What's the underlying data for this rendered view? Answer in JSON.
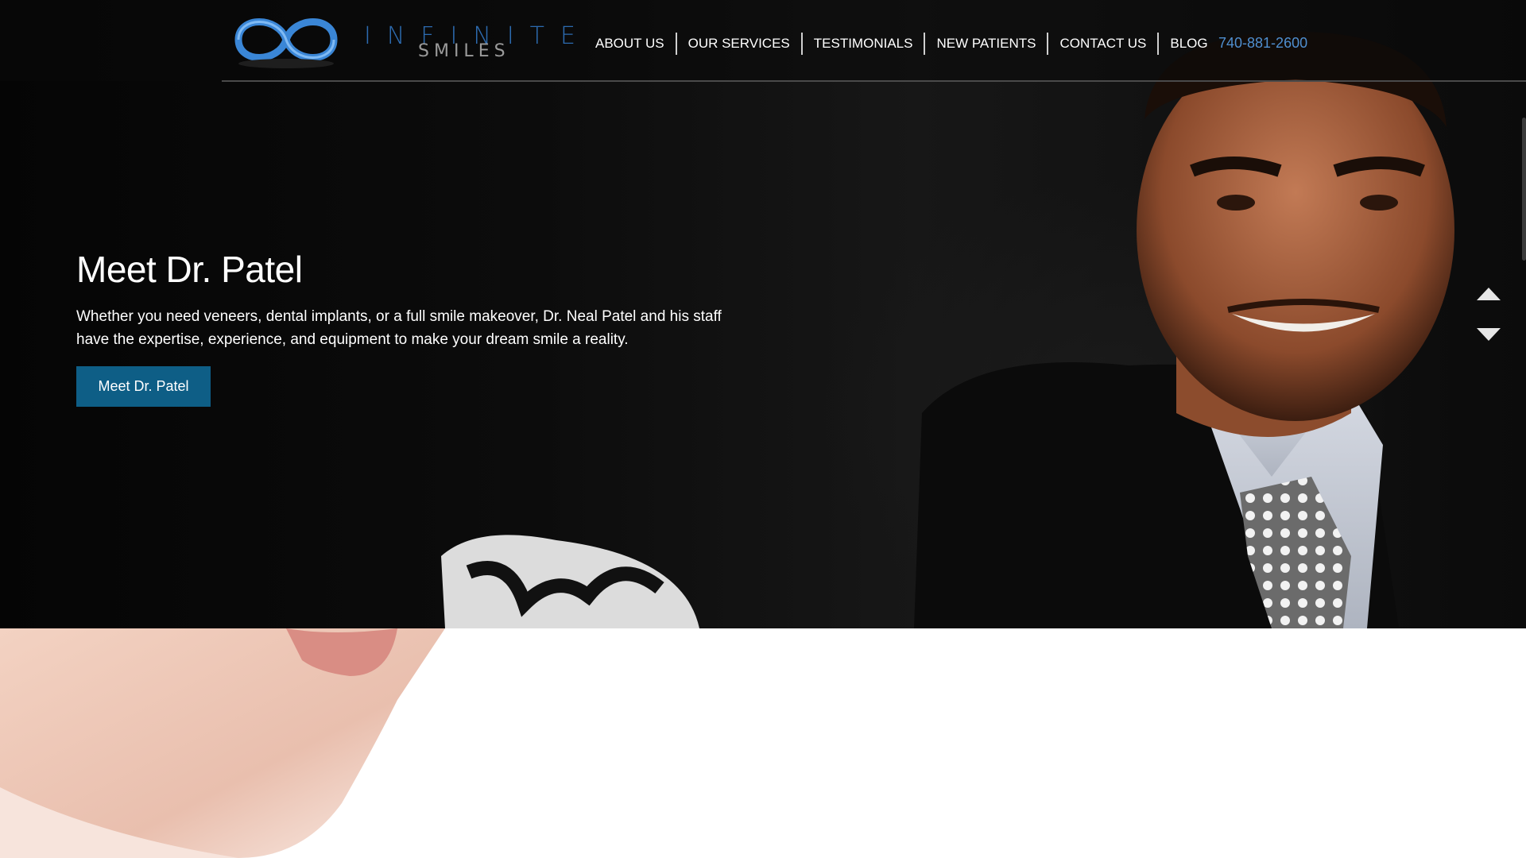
{
  "logo": {
    "line1": "INFINITE",
    "line2": "SMILES"
  },
  "nav": {
    "items": [
      "ABOUT US",
      "OUR SERVICES",
      "TESTIMONIALS",
      "NEW PATIENTS",
      "CONTACT US",
      "BLOG"
    ]
  },
  "phone": "740-881-2600",
  "hero": {
    "title": "Meet Dr. Patel",
    "body": "Whether you need veneers, dental implants, or a full smile makeover, Dr. Neal Patel and his staff have the expertise, experience, and equipment to make your dream smile a reality.",
    "cta": "Meet Dr. Patel"
  },
  "icons": {
    "slider_prev": "chevron-up-icon",
    "slider_next": "chevron-down-icon"
  },
  "colors": {
    "accent": "#0e5e86",
    "phone": "#4f8fd0",
    "logo_blue": "#2d6bb0"
  }
}
